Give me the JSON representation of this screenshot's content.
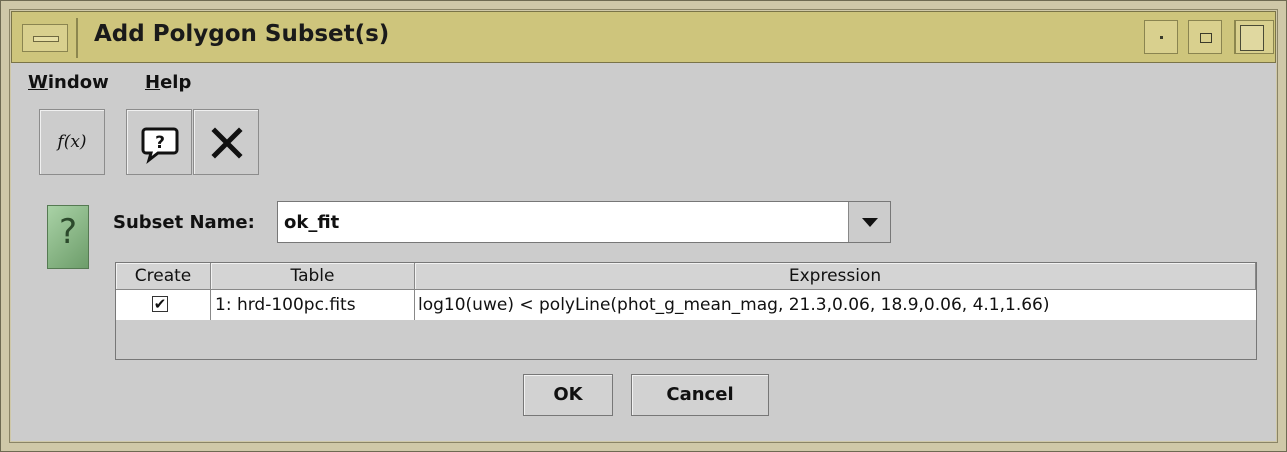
{
  "window": {
    "title": "Add Polygon Subset(s)"
  },
  "menubar": {
    "items": [
      {
        "label": "Window",
        "mnemonic": "W",
        "rest": "indow"
      },
      {
        "label": "Help",
        "mnemonic": "H",
        "rest": "elp"
      }
    ]
  },
  "toolbar": {
    "function_label": "f(x)",
    "icons": [
      "function-icon",
      "help-balloon-icon",
      "close-icon"
    ]
  },
  "form": {
    "subset_name_label": "Subset Name:",
    "subset_name_value": "ok_fit"
  },
  "table": {
    "headers": [
      "Create",
      "Table",
      "Expression"
    ],
    "rows": [
      {
        "create": true,
        "table": "1: hrd-100pc.fits",
        "expression": "log10(uwe) < polyLine(phot_g_mean_mag, 21.3,0.06, 18.9,0.06, 4.1,1.66)"
      }
    ]
  },
  "buttons": {
    "ok": "OK",
    "cancel": "Cancel"
  },
  "colors": {
    "titlebar": "#cec57c",
    "client_bg": "#cccccc",
    "help_icon": "#8fbf8c"
  }
}
